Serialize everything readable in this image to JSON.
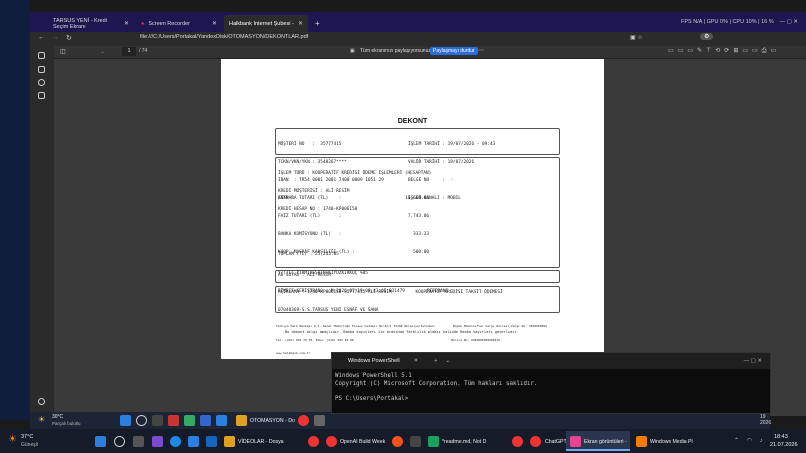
{
  "browser": {
    "tabs": [
      {
        "label": "TARSUS YENİ - Kredi Seçim Ekranı"
      },
      {
        "label": "Screen Recorder"
      },
      {
        "label": "Halkbank İnternet Şubesi - DEKONT"
      }
    ],
    "new_tab": "+",
    "status": "FPS N/A | GPU 0% | CPU 10% | 16 %",
    "url": "file:///C:/Users/Portakal/YandexDisk/OTOMASYON/DEKONTLAR.pdf"
  },
  "pdf_toolbar": {
    "page_current": "1",
    "page_total": "/ 74",
    "share_text": "Tüm ekranınızı paylaşıyorsunuz.",
    "stop_button": "Paylaşmayı durdur"
  },
  "dekont": {
    "title": "DEKONT",
    "header_left": [
      "MÜŞTERİ NO   :  35777415",
      "TCKN/VKN/YKN : 3548267****",
      "IBAN  : TR54 0001 2001 7400 0009 1051 29",
      "ETTN :  -"
    ],
    "header_right": [
      "İŞLEM TARİHİ : 19/07/2026 - 09:43",
      "VALÖR TARİHİ : 19/07/2026",
      "BELGE NO     :  -",
      "İŞLEM KANALI : MOBIL"
    ],
    "details": [
      "İŞLEM TÜRÜ : KOOPERATİF KREDİSİ ÖDEME İŞLEMLERİ (HESAPTAN)",
      "KREDİ MÜŞTERİSİ : ALİ RESİM",
      "KREDİ HESAP NO : 1740-KP006150"
    ],
    "amounts": [
      {
        "label": "ANAPARA TUTARI (TL)    :",
        "value": "16,666.66"
      },
      {
        "label": "FAİZ TUTARI (TL)       :",
        "value": "7,743.06"
      },
      {
        "label": "BANKA KOMİSYONU (TL)   :",
        "value": "333.33"
      },
      {
        "label": "KOOP. MASRAF KARŞILIĞI (TL) :",
        "value": "500.00"
      }
    ],
    "totals": [
      "TOPLAM (TL) : 25,243.05",
      "Y/(TL) YİRMİBEŞBİNİKİYÜZKIRKÜÇ %05",
      "AÇIKLAMA : 1740-KP006150 35777415 ALİ RESİM         KOOPERATİF KREDİSİ TAKSİT ÖDEMESİ",
      "07040369-S.S.TARSUS YENİ ESNAF VE SANA"
    ],
    "name_line": "AD SOYAD : ALİ RESİM",
    "bimref_left": "BİMREF-SERİSIRANO : M-2026-07-19-09.43.05.031479",
    "bimref_right": "REFERANS : -",
    "footer": [
      "Türkiye Halk Bankası A.Ş. Genel Müdürlüğü Finans Caddesi No:42/1 34760 Ümraniye/İstanbul          Büyük Mükellefler Vergi Dairesi Vergi No: 4560004899",
      "Tel: (216) 503 70 70  Faks: (216) 503 50 00                                                      Mersis No: 0456000489900116",
      "www.halkbank.com.tr                                                                                 Ticaret Sicil No: 886370"
    ],
    "footer_note": "Bu dekont bilgi amaçlıdır. Banka kayıtları ile arasında farklılık olması halinde Banka kayıtları geçerlidir."
  },
  "powershell": {
    "title": "Windows PowerShell",
    "lines": [
      "Windows PowerShell 5.1",
      "Copyright (C) Microsoft Corporation. Tüm hakları saklıdır.",
      "",
      "PS C:\\Users\\Portakal>"
    ]
  },
  "second_taskbar": {
    "weather_temp": "30°C",
    "weather_desc": "Parçalı bulutlu",
    "item_label": "OTOMASYON - Do"
  },
  "taskbar": {
    "weather_temp": "37°C",
    "weather_desc": "Güneşli",
    "apps": [
      {
        "label": "VİDEOLAR - Dosya"
      },
      {
        "label": "OpenAI Build Week"
      },
      {
        "label": "*readme.md, Not D"
      },
      {
        "label": "ChatGPT"
      },
      {
        "label": "Ekran görüntüleri -"
      },
      {
        "label": "Windows Media Pl"
      }
    ],
    "time": "18:43",
    "date": "21.07.2026",
    "side_num": "19",
    "side_date": "2026"
  }
}
